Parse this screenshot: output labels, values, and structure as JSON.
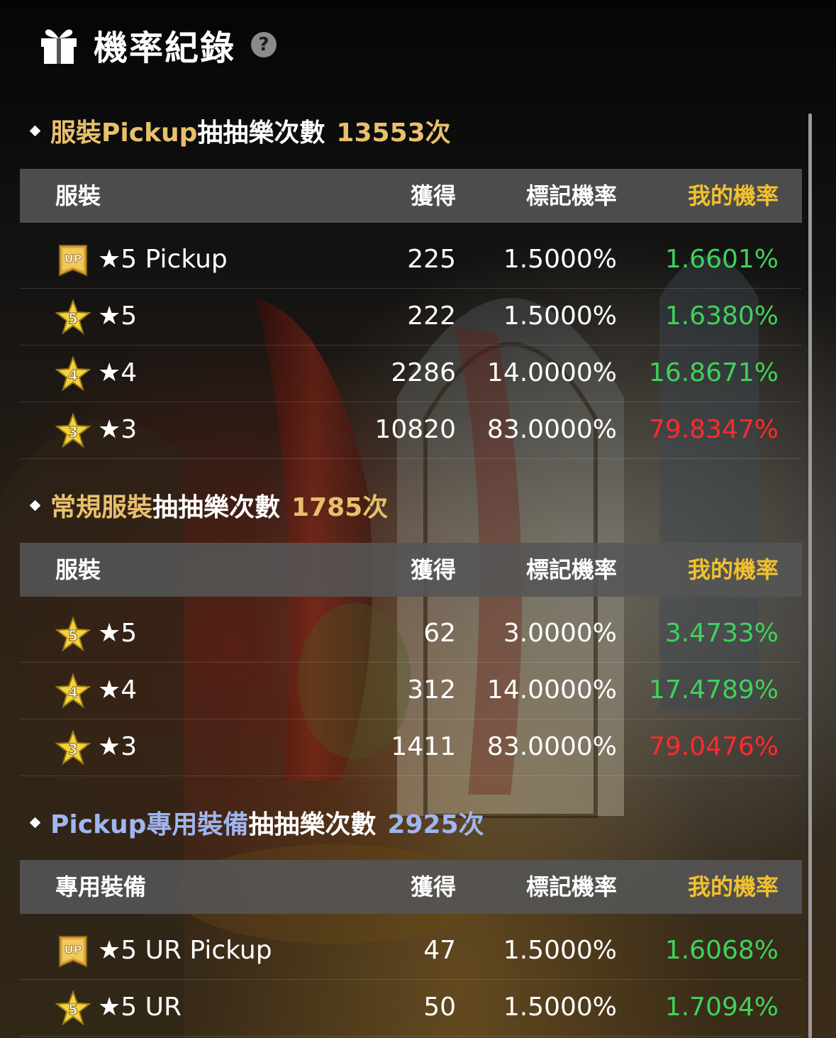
{
  "header": {
    "title": "機率紀錄",
    "help_symbol": "?",
    "icon": "gift-icon"
  },
  "colors": {
    "gold": "#e8c06c",
    "blue": "#9fb6ef",
    "my_rate_header": "#f2c12e",
    "green": "#3fd25a",
    "red": "#ff2b2b"
  },
  "sections": [
    {
      "title_highlight": "服裝Pickup",
      "title_plain": "抽抽樂次數",
      "count": "13553次",
      "columns": {
        "name": "服裝",
        "got": "獲得",
        "rate": "標記機率",
        "mine": "我的機率"
      },
      "rows": [
        {
          "badge": "up-badge-icon",
          "name": "★5 Pickup",
          "got": "225",
          "rate": "1.5000%",
          "mine": "1.6601%",
          "mine_color": "green"
        },
        {
          "badge": "star-5-badge-icon",
          "name": "★5",
          "got": "222",
          "rate": "1.5000%",
          "mine": "1.6380%",
          "mine_color": "green"
        },
        {
          "badge": "star-4-badge-icon",
          "name": "★4",
          "got": "2286",
          "rate": "14.0000%",
          "mine": "16.8671%",
          "mine_color": "green"
        },
        {
          "badge": "star-3-badge-icon",
          "name": "★3",
          "got": "10820",
          "rate": "83.0000%",
          "mine": "79.8347%",
          "mine_color": "red"
        }
      ]
    },
    {
      "title_highlight": "常規服裝",
      "title_plain": "抽抽樂次數",
      "count": "1785次",
      "columns": {
        "name": "服裝",
        "got": "獲得",
        "rate": "標記機率",
        "mine": "我的機率"
      },
      "rows": [
        {
          "badge": "star-5-badge-icon",
          "name": "★5",
          "got": "62",
          "rate": "3.0000%",
          "mine": "3.4733%",
          "mine_color": "green"
        },
        {
          "badge": "star-4-badge-icon",
          "name": "★4",
          "got": "312",
          "rate": "14.0000%",
          "mine": "17.4789%",
          "mine_color": "green"
        },
        {
          "badge": "star-3-badge-icon",
          "name": "★3",
          "got": "1411",
          "rate": "83.0000%",
          "mine": "79.0476%",
          "mine_color": "red"
        }
      ]
    },
    {
      "title_highlight": "Pickup專用裝備",
      "title_plain": "抽抽樂次數",
      "count": "2925次",
      "columns": {
        "name": "專用裝備",
        "got": "獲得",
        "rate": "標記機率",
        "mine": "我的機率"
      },
      "rows": [
        {
          "badge": "up-badge-icon",
          "name": "★5 UR Pickup",
          "got": "47",
          "rate": "1.5000%",
          "mine": "1.6068%",
          "mine_color": "green"
        },
        {
          "badge": "star-5-badge-icon",
          "name": "★5 UR",
          "got": "50",
          "rate": "1.5000%",
          "mine": "1.7094%",
          "mine_color": "green"
        }
      ]
    }
  ]
}
